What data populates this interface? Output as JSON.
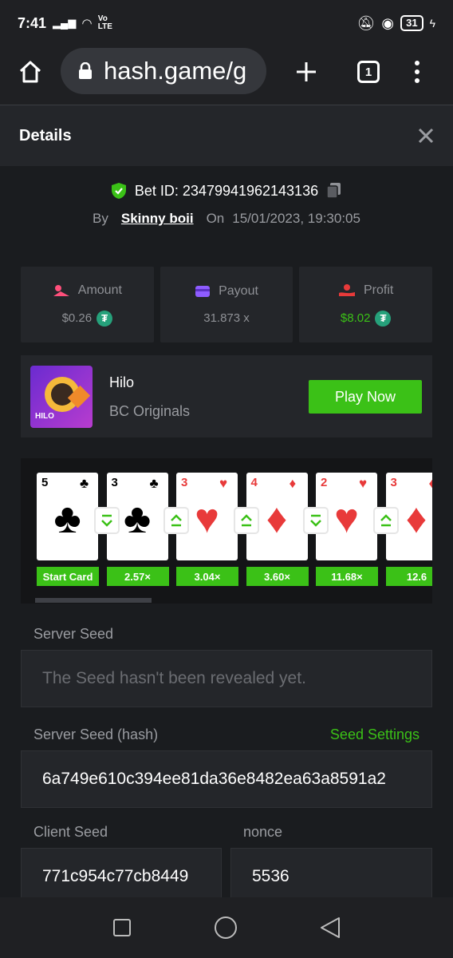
{
  "status_bar": {
    "time": "7:41",
    "network": "Vo LTE",
    "battery": "31"
  },
  "browser": {
    "url": "hash.game/g",
    "tab_count": "1"
  },
  "dialog": {
    "title": "Details"
  },
  "bet": {
    "id_label": "Bet ID: 23479941962143136",
    "by_label": "By",
    "user": "Skinny boii",
    "on_label": "On",
    "datetime": "15/01/2023, 19:30:05"
  },
  "stats": [
    {
      "label": "Amount",
      "value": "$0.26",
      "color": "#ffffff"
    },
    {
      "label": "Payout",
      "value": "31.873 x",
      "color": "#8f9196"
    },
    {
      "label": "Profit",
      "value": "$8.02",
      "color": "#3bc117"
    }
  ],
  "game": {
    "name": "Hilo",
    "provider": "BC Originals",
    "play_label": "Play Now",
    "thumb_text": "HILO"
  },
  "cards": [
    {
      "rank": "5",
      "suit": "♣",
      "color": "#000000",
      "label": "Start Card"
    },
    {
      "rank": "3",
      "suit": "♣",
      "color": "#000000",
      "label": "2.57×",
      "arrow": "down"
    },
    {
      "rank": "3",
      "suit": "♥",
      "color": "#e83a3a",
      "label": "3.04×",
      "arrow": "up"
    },
    {
      "rank": "4",
      "suit": "♦",
      "color": "#e83a3a",
      "label": "3.60×",
      "arrow": "up"
    },
    {
      "rank": "2",
      "suit": "♥",
      "color": "#e83a3a",
      "label": "11.68×",
      "arrow": "down"
    },
    {
      "rank": "3",
      "suit": "♦",
      "color": "#e83a3a",
      "label": "12.6",
      "arrow": "up"
    }
  ],
  "seeds": {
    "server_seed_label": "Server Seed",
    "server_seed_value": "The Seed hasn't been revealed yet.",
    "server_hash_label": "Server Seed (hash)",
    "seed_settings_label": "Seed Settings",
    "server_hash_value": "6a749e610c394ee81da36e8482ea63a8591a2",
    "client_seed_label": "Client Seed",
    "client_seed_value": "771c954c77cb8449",
    "nonce_label": "nonce",
    "nonce_value": "5536"
  }
}
